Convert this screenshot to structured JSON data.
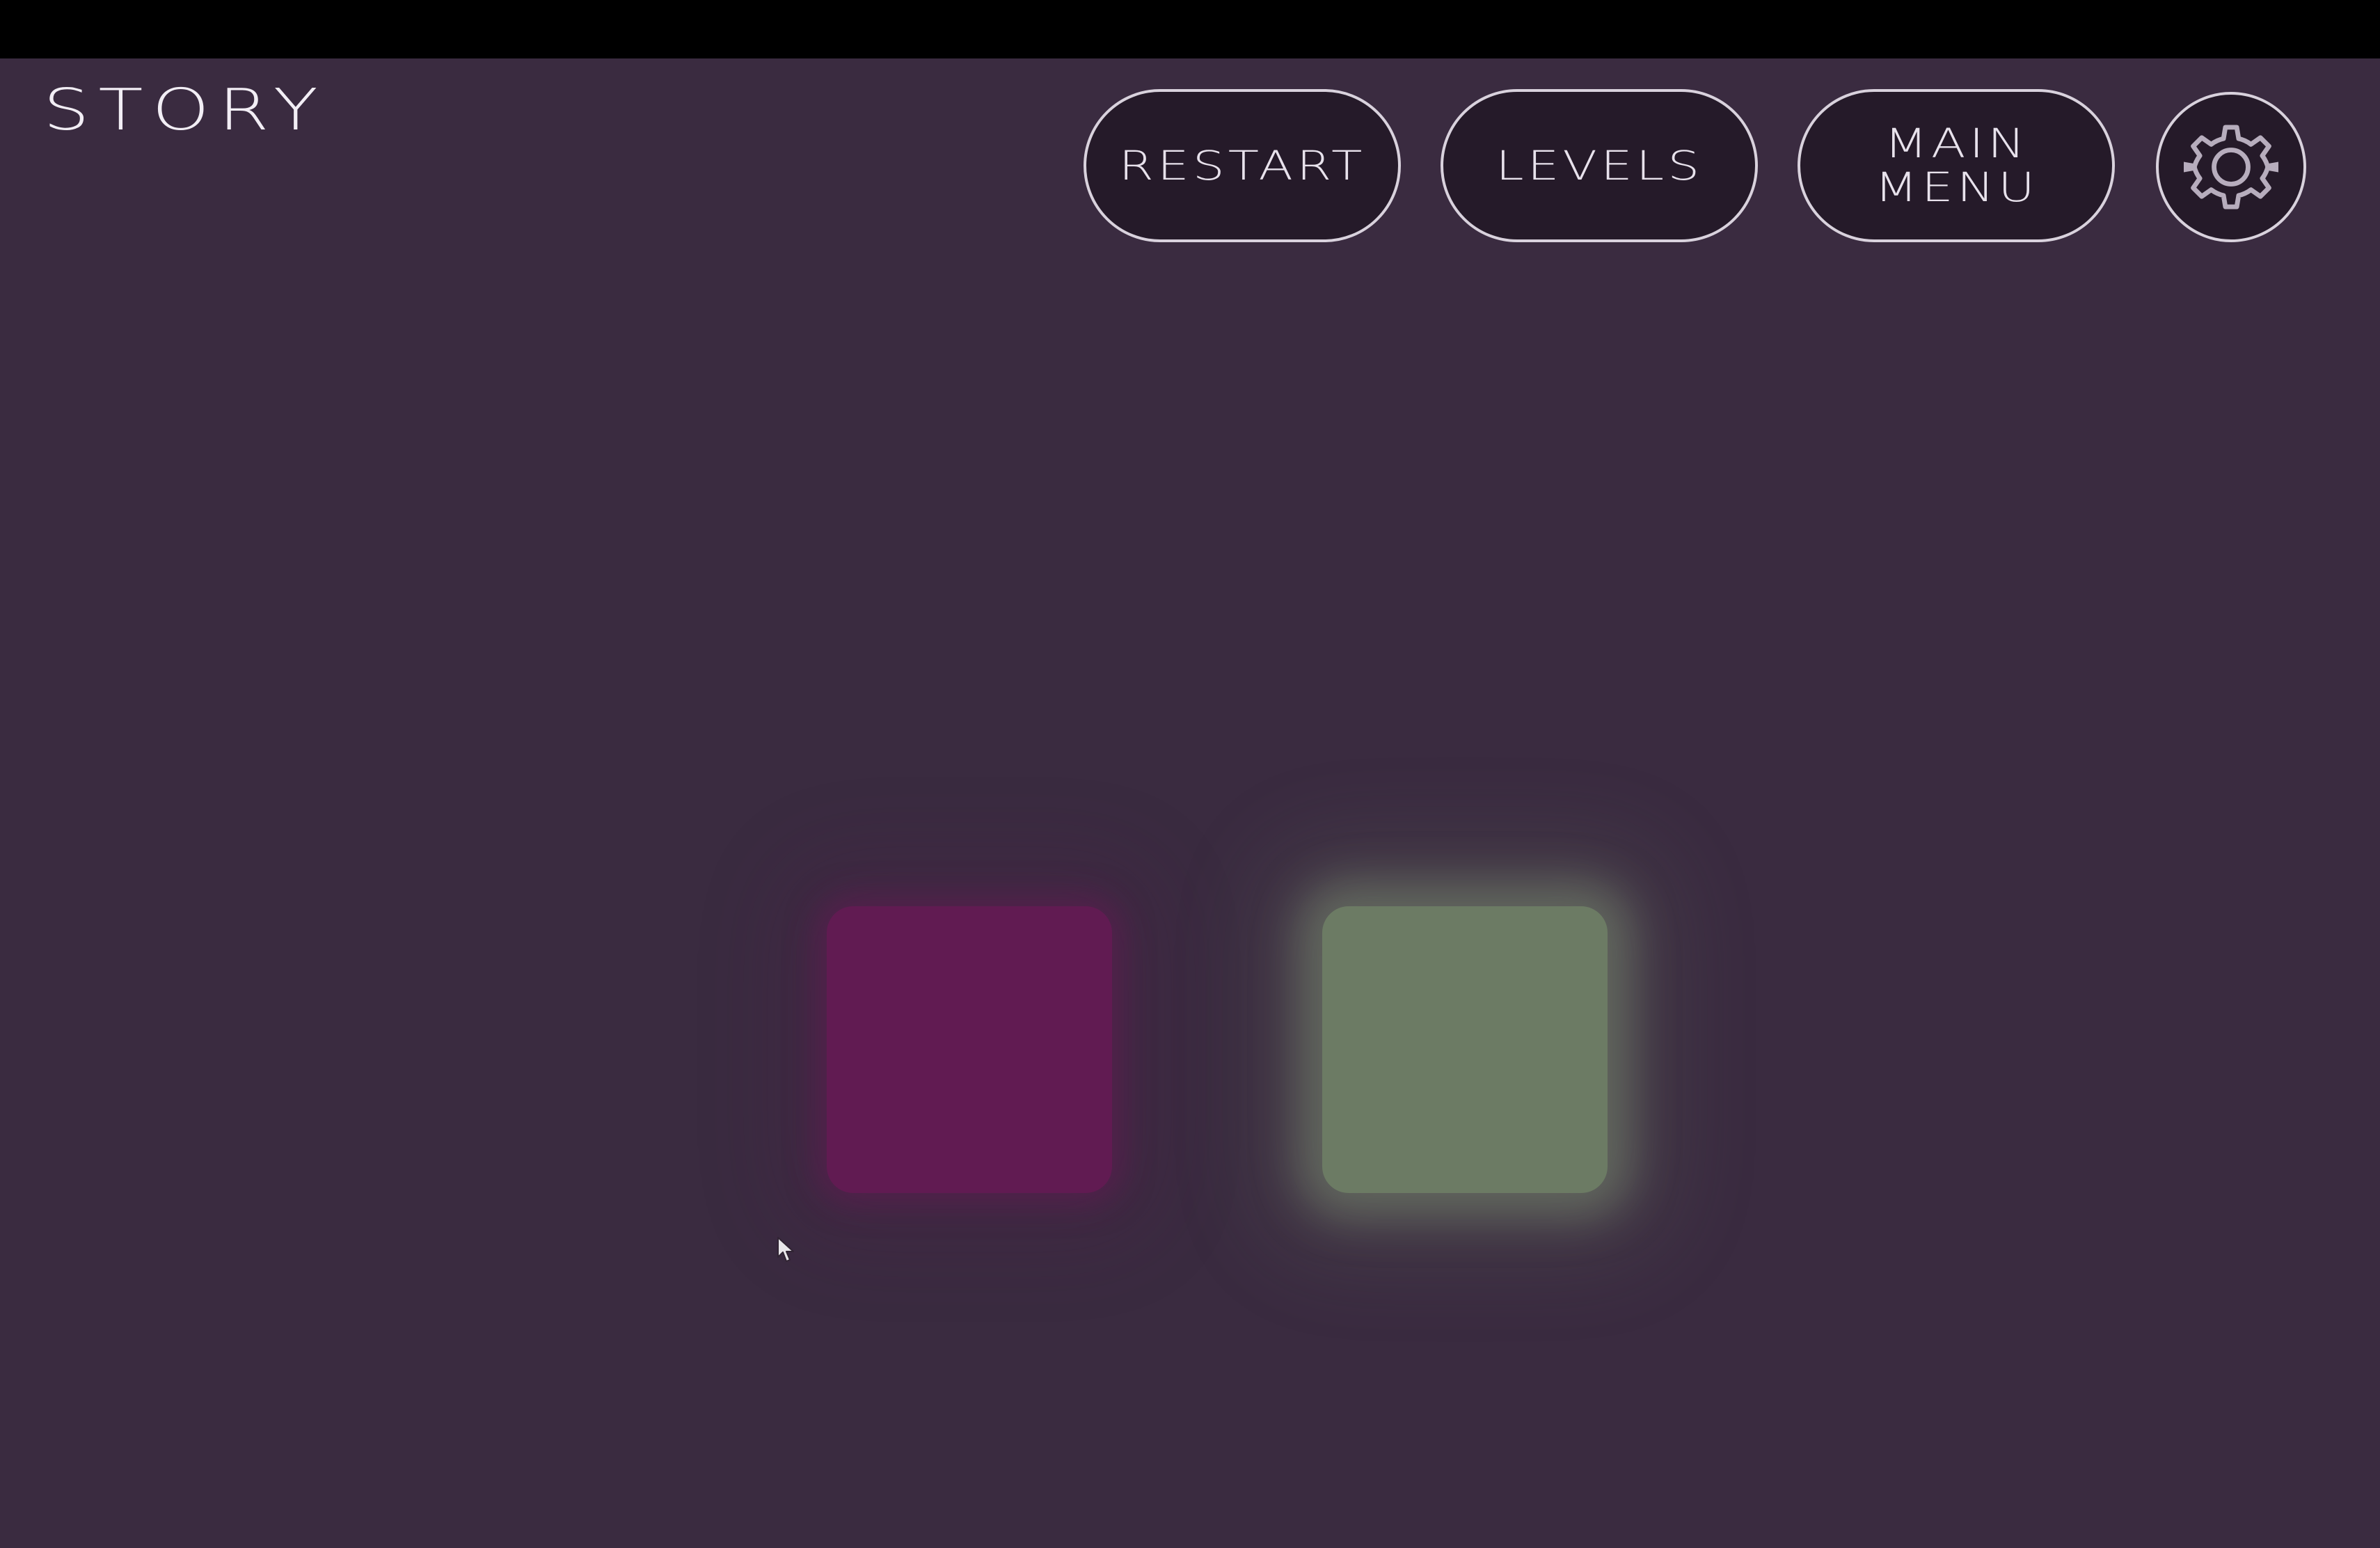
{
  "game": {
    "mode_title": "STORY"
  },
  "toolbar": {
    "restart_label": "RESTART",
    "levels_label": "LEVELS",
    "main_menu_label": "MAIN\nMENU",
    "settings_icon": "gear-icon"
  },
  "board": {
    "tiles": [
      {
        "name": "magenta-tile",
        "color": "#611b52"
      },
      {
        "name": "green-tile",
        "color": "#6c7b64"
      }
    ]
  },
  "theme": {
    "background": "#3a2b40",
    "button_fill": "#251a29",
    "button_outline": "#d9d2dd",
    "text": "#f2eef5"
  }
}
